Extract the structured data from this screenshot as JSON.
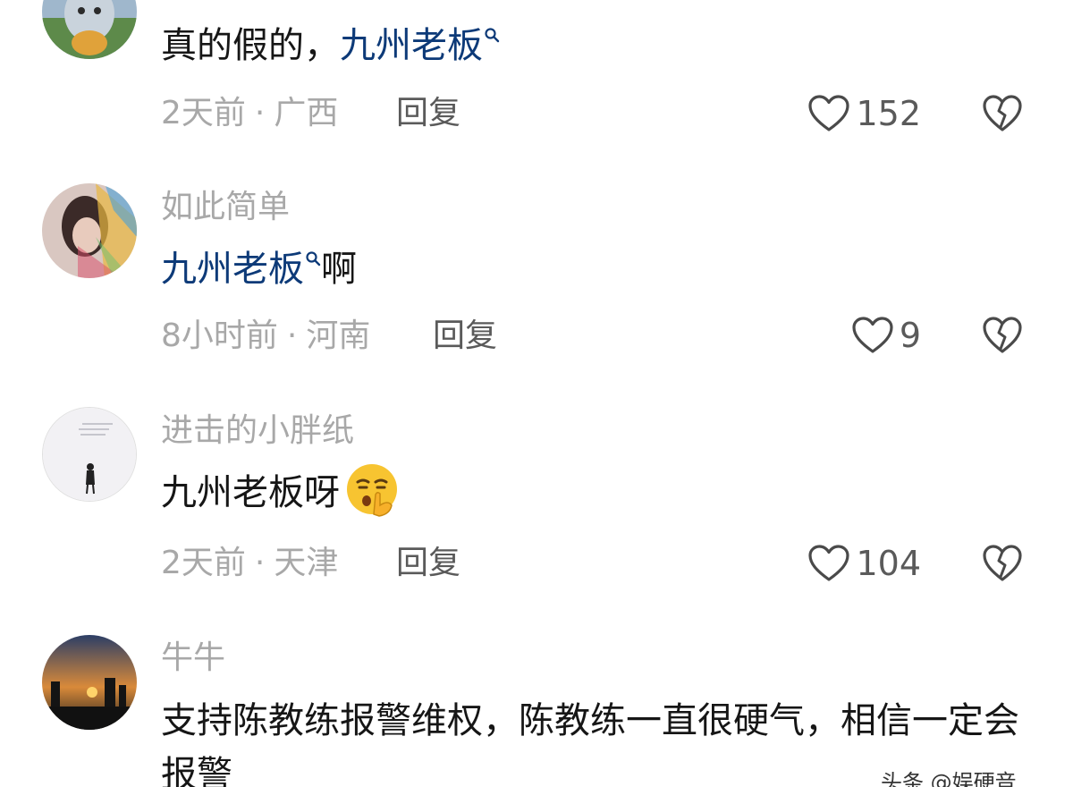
{
  "comments": [
    {
      "username": "",
      "content_plain": "真的假的，",
      "content_link": "九州老板",
      "content_suffix": "",
      "time": "2天前",
      "separator": "·",
      "location": "广西",
      "reply_label": "回复",
      "likes": "152"
    },
    {
      "username": "如此简单",
      "content_plain": "",
      "content_link": "九州老板",
      "content_suffix": "啊",
      "time": "8小时前",
      "separator": "·",
      "location": "河南",
      "reply_label": "回复",
      "likes": "9"
    },
    {
      "username": "进击的小胖纸",
      "content_plain": "九州老板呀",
      "emoji": "shushing-face-emoji",
      "time": "2天前",
      "separator": "·",
      "location": "天津",
      "reply_label": "回复",
      "likes": "104"
    },
    {
      "username": "牛牛",
      "content_plain": "支持陈教练报警维权，陈教练一直很硬气，相信一定会报警"
    }
  ],
  "watermark": "头条 @娱硬音",
  "icons": {
    "like": "heart-outline-icon",
    "dislike": "broken-heart-icon",
    "link_search": "search-mark-icon"
  },
  "colors": {
    "link": "#0d3a78",
    "meta": "#a8a8a8",
    "text": "#161616"
  }
}
